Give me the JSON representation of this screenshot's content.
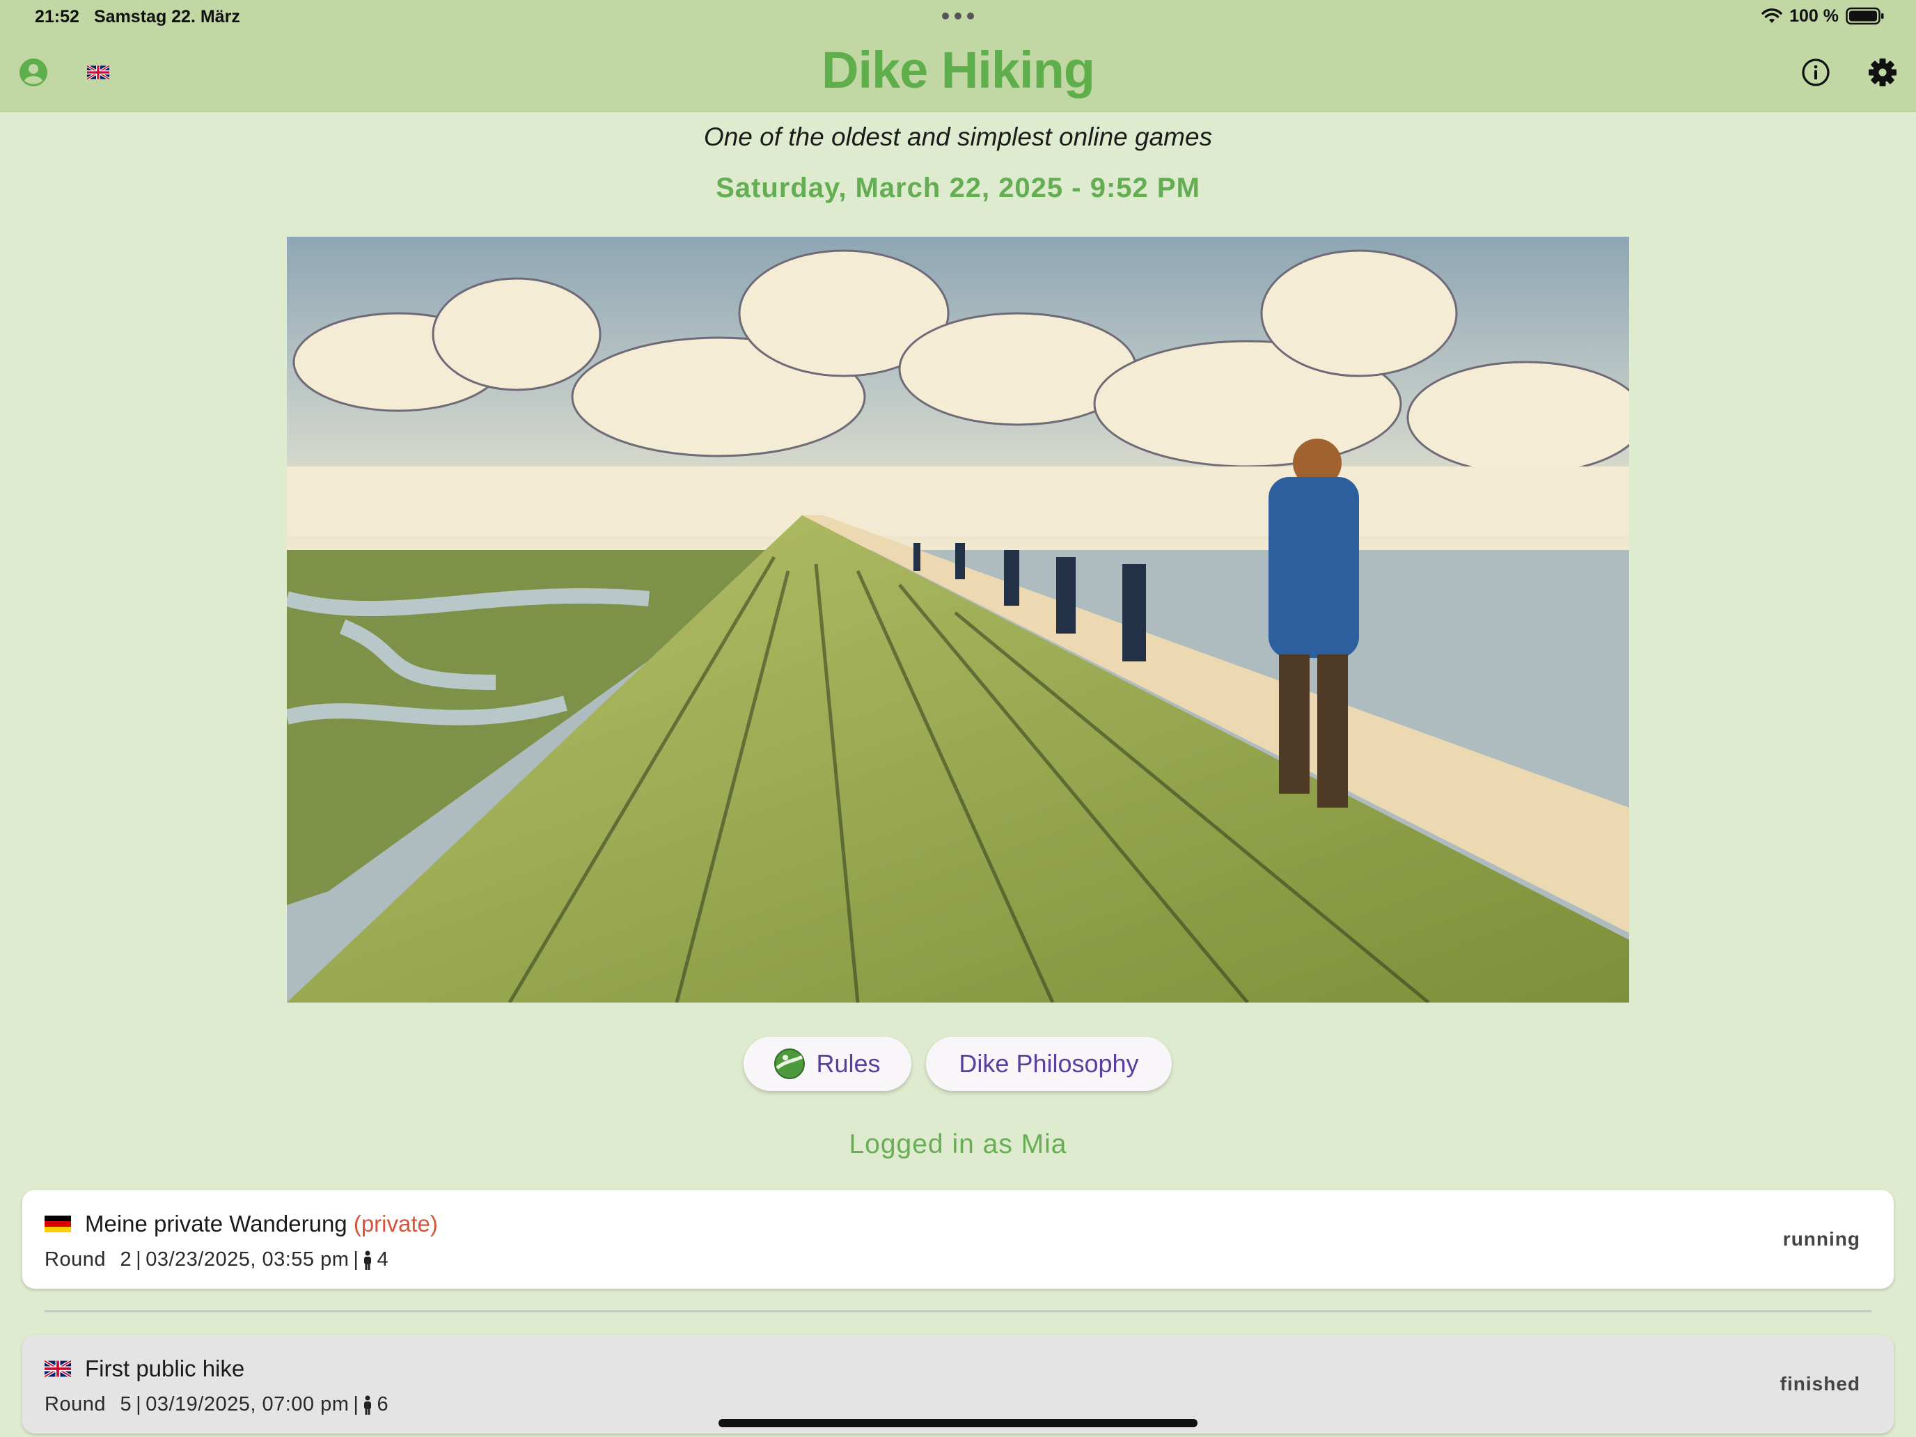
{
  "status_bar": {
    "time": "21:52",
    "date": "Samstag 22. März",
    "battery": "100 %"
  },
  "header": {
    "title": "Dike Hiking",
    "icons": [
      "profile-icon",
      "uk-flag-icon",
      "info-icon",
      "gear-icon"
    ]
  },
  "main": {
    "subtitle": "One of the oldest and simplest online games",
    "datetime": "Saturday, March 22, 2025 - 9:52 PM",
    "rules_label": "Rules",
    "philosophy_label": "Dike Philosophy",
    "logged_in": "Logged in as Mia"
  },
  "games": [
    {
      "flag": "de",
      "name": "Meine private Wanderung",
      "tag": "(private)",
      "round_label": "Round",
      "round": "2",
      "datetime": "03/23/2025, 03:55 pm",
      "players": "4",
      "status": "running"
    },
    {
      "flag": "gb",
      "name": "First public hike",
      "tag": "",
      "round_label": "Round",
      "round": "5",
      "datetime": "03/19/2025, 07:00 pm",
      "players": "6",
      "status": "finished"
    }
  ],
  "colors": {
    "header_bg": "#c1d7a4",
    "page_bg": "#dfebce",
    "accent_green": "#5fae4c",
    "button_text": "#5a3f9e",
    "private_red": "#d9533b"
  }
}
